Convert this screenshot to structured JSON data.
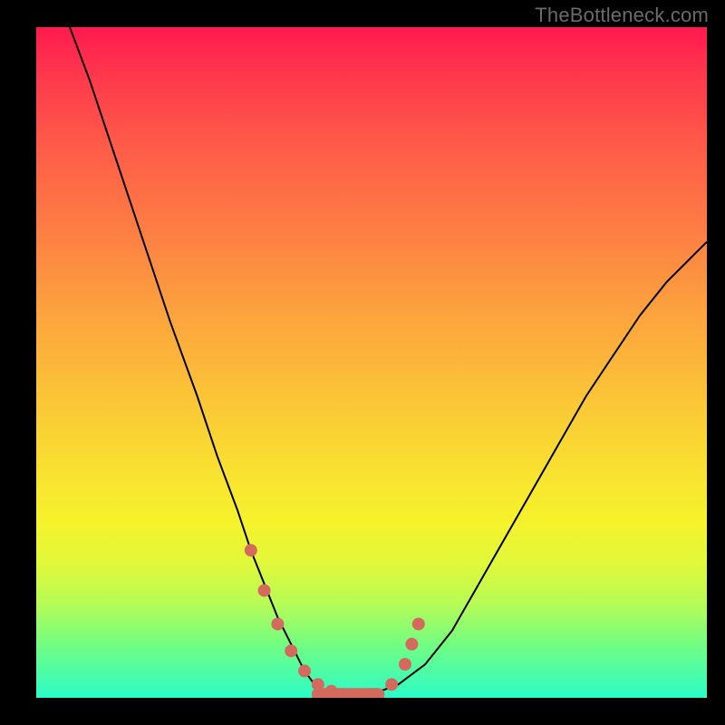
{
  "watermark": "TheBottleneck.com",
  "colors": {
    "background": "#000000",
    "gradient_top": "#ff1a4f",
    "gradient_mid": "#f9e130",
    "gradient_bottom": "#2bfcc8",
    "curve": "#000000",
    "marker": "#d4695e"
  },
  "chart_data": {
    "type": "line",
    "title": "",
    "xlabel": "",
    "ylabel": "",
    "xlim": [
      0,
      100
    ],
    "ylim": [
      0,
      100
    ],
    "grid": false,
    "legend": false,
    "series": [
      {
        "name": "curve",
        "x": [
          5,
          8,
          12,
          16,
          20,
          24,
          27,
          30,
          32,
          34,
          36,
          38,
          40,
          41.5,
          43,
          45,
          48,
          50,
          54,
          58,
          62,
          66,
          70,
          74,
          78,
          82,
          86,
          90,
          94,
          98,
          100
        ],
        "y": [
          100,
          92,
          80,
          68,
          56,
          45,
          36,
          28,
          22,
          17,
          12,
          8,
          4,
          2,
          1,
          0.5,
          0.5,
          0.5,
          2,
          5,
          10,
          17,
          24,
          31,
          38,
          45,
          51,
          57,
          62,
          66,
          68
        ]
      }
    ],
    "markers": [
      {
        "x": 32,
        "y": 22
      },
      {
        "x": 34,
        "y": 16
      },
      {
        "x": 36,
        "y": 11
      },
      {
        "x": 38,
        "y": 7
      },
      {
        "x": 40,
        "y": 4
      },
      {
        "x": 42,
        "y": 2
      },
      {
        "x": 44,
        "y": 1
      },
      {
        "x": 46,
        "y": 0.5
      },
      {
        "x": 48,
        "y": 0.5
      },
      {
        "x": 50,
        "y": 0.5
      },
      {
        "x": 53,
        "y": 2
      },
      {
        "x": 55,
        "y": 5
      },
      {
        "x": 56,
        "y": 8
      },
      {
        "x": 57,
        "y": 11
      }
    ],
    "flat_segment": {
      "x_start": 42,
      "x_end": 51,
      "y": 0.5
    }
  }
}
